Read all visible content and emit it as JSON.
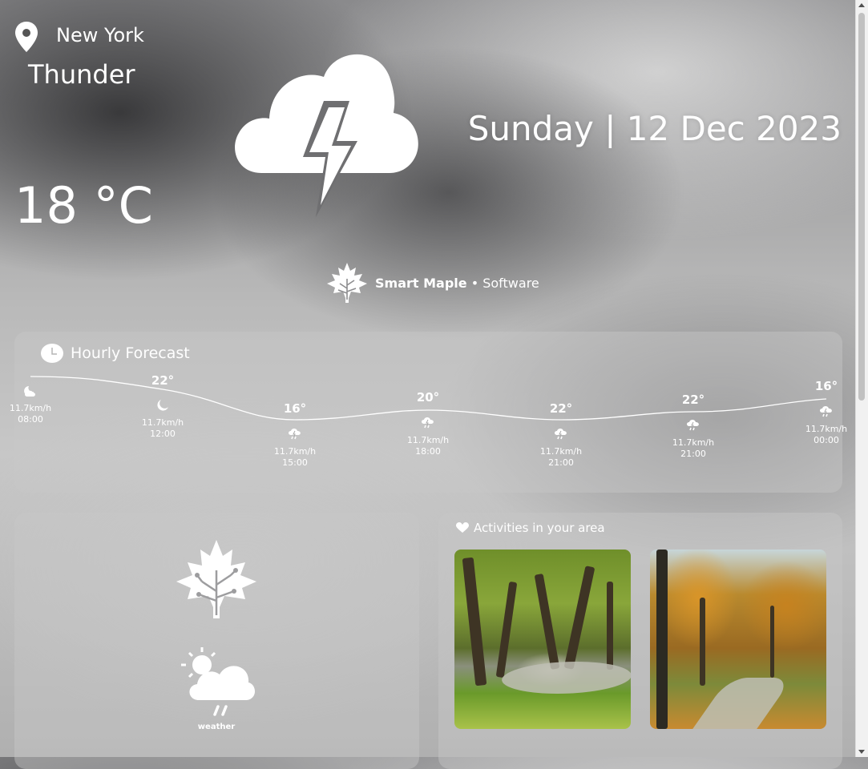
{
  "location": {
    "city": "New York",
    "icon": "map-pin-icon"
  },
  "current": {
    "condition": "Thunder",
    "temperature": "18 °C",
    "icon": "thunder-cloud-icon"
  },
  "date": {
    "text": "Sunday | 12 Dec 2023"
  },
  "brand": {
    "name": "Smart Maple",
    "separator": "•",
    "suffix": "Software",
    "icon": "maple-leaf-icon"
  },
  "hourly": {
    "title": "Hourly Forecast",
    "icon": "clock-icon",
    "items": [
      {
        "temp": "",
        "wind": "11.7km/h",
        "time": "08:00",
        "icon": "moon-cloud-icon"
      },
      {
        "temp": "22°",
        "wind": "11.7km/h",
        "time": "12:00",
        "icon": "moon-icon"
      },
      {
        "temp": "16°",
        "wind": "11.7km/h",
        "time": "15:00",
        "icon": "rain-cloud-icon"
      },
      {
        "temp": "20°",
        "wind": "11.7km/h",
        "time": "18:00",
        "icon": "rain-cloud-icon"
      },
      {
        "temp": "22°",
        "wind": "11.7km/h",
        "time": "21:00",
        "icon": "rain-cloud-icon"
      },
      {
        "temp": "22°",
        "wind": "11.7km/h",
        "time": "21:00",
        "icon": "rain-cloud-icon"
      },
      {
        "temp": "16°",
        "wind": "11.7km/h",
        "time": "00:00",
        "icon": "rain-cloud-icon"
      }
    ]
  },
  "widget": {
    "label": "weather",
    "icons": [
      "maple-leaf-icon",
      "sun-rain-cloud-icon"
    ]
  },
  "activities": {
    "title": "Activities in your area",
    "icon": "heart-icon",
    "photos": [
      "park-trees-photo",
      "autumn-park-photo"
    ]
  },
  "colors": {
    "panel": "#c8c8c8",
    "text": "#ffffff"
  }
}
